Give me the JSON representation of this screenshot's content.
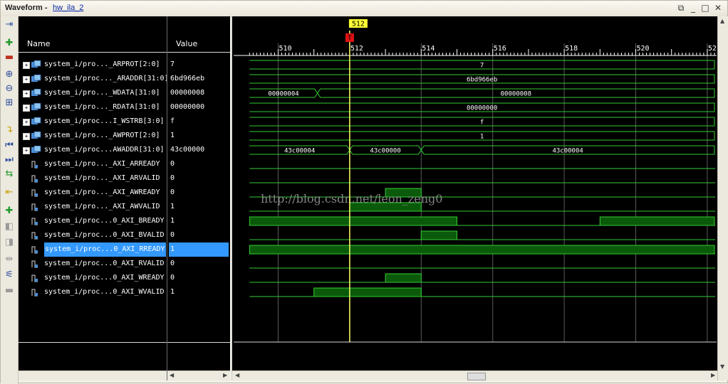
{
  "window": {
    "title_label": "Waveform",
    "title_separator": "-",
    "title_link": "hw_ila_2",
    "controls": {
      "restore": "⧉",
      "minimize": "_",
      "maximize": "□",
      "close": "✕"
    }
  },
  "toolbar": {
    "buttons": [
      {
        "name": "waveform-options-button",
        "icon": "⇥",
        "color": "#3a5fa8"
      },
      {
        "name": "add-probe-button",
        "icon": "✚",
        "color": "#1f9a2b"
      },
      {
        "name": "remove-button",
        "icon": "▬",
        "color": "#c03020"
      },
      {
        "name": "zoom-in-button",
        "icon": "⊕",
        "color": "#2a4c9a"
      },
      {
        "name": "zoom-out-button",
        "icon": "⊖",
        "color": "#2a4c9a"
      },
      {
        "name": "zoom-fit-button",
        "icon": "⊞",
        "color": "#2a4c9a"
      },
      {
        "name": "go-to-cursor-button",
        "icon": "↴",
        "color": "#c8a000"
      },
      {
        "name": "go-to-time-0-button",
        "icon": "⏮",
        "color": "#2a4c9a"
      },
      {
        "name": "go-to-last-time-button",
        "icon": "⏭",
        "color": "#2a4c9a"
      },
      {
        "name": "swap-cursors-button",
        "icon": "⇆",
        "color": "#1f9a2b"
      },
      {
        "name": "previous-transition-button",
        "icon": "⇤",
        "color": "#c8a000"
      },
      {
        "name": "add-marker-button",
        "icon": "✚",
        "color": "#1f9a2b"
      },
      {
        "name": "previous-marker-button",
        "icon": "◧",
        "color": "#9a9a9a"
      },
      {
        "name": "next-marker-button",
        "icon": "◨",
        "color": "#9a9a9a"
      },
      {
        "name": "snap-to-transition-button",
        "icon": "⇹",
        "color": "#9a9a9a"
      },
      {
        "name": "floating-ruler-button",
        "icon": "⚟",
        "color": "#2a4c9a"
      },
      {
        "name": "sync-button",
        "icon": "▬",
        "color": "#9a9a9a"
      }
    ]
  },
  "columns": {
    "name_header": "Name",
    "value_header": "Value"
  },
  "signals": [
    {
      "name": "system_i/pro..._ARPROT[2:0]",
      "value": "7",
      "type": "bus",
      "expandable": true
    },
    {
      "name": "system_i/proc..._ARADDR[31:0]",
      "value": "6bd966eb",
      "type": "bus",
      "expandable": true
    },
    {
      "name": "system_i/pro..._WDATA[31:0]",
      "value": "00000008",
      "type": "bus",
      "expandable": true
    },
    {
      "name": "system_i/pro..._RDATA[31:0]",
      "value": "00000000",
      "type": "bus",
      "expandable": true
    },
    {
      "name": "system_i/proc...I_WSTRB[3:0]",
      "value": "f",
      "type": "bus",
      "expandable": true
    },
    {
      "name": "system_i/pro..._AWPROT[2:0]",
      "value": "1",
      "type": "bus",
      "expandable": true
    },
    {
      "name": "system_i/proc...AWADDR[31:0]",
      "value": "43c00000",
      "type": "bus",
      "expandable": true
    },
    {
      "name": "system_i/pro..._AXI_ARREADY",
      "value": "0",
      "type": "bit"
    },
    {
      "name": "system_i/pro..._AXI_ARVALID",
      "value": "0",
      "type": "bit"
    },
    {
      "name": "system_i/pro..._AXI_AWREADY",
      "value": "0",
      "type": "bit"
    },
    {
      "name": "system_i/pro..._AXI_AWVALID",
      "value": "1",
      "type": "bit"
    },
    {
      "name": "system_i/proc...0_AXI_BREADY",
      "value": "1",
      "type": "bit"
    },
    {
      "name": "system_i/proc...0_AXI_BVALID",
      "value": "0",
      "type": "bit"
    },
    {
      "name": "system_i/proc...0_AXI_RREADY",
      "value": "1",
      "type": "bit",
      "selected": true
    },
    {
      "name": "system_i/proc...0_AXI_RVALID",
      "value": "0",
      "type": "bit"
    },
    {
      "name": "system_i/proc...0_AXI_WREADY",
      "value": "0",
      "type": "bit"
    },
    {
      "name": "system_i/proc...0_AXI_WVALID",
      "value": "1",
      "type": "bit"
    }
  ],
  "timeline": {
    "tick_labels": [
      "510",
      "512",
      "514",
      "516",
      "518",
      "520",
      "52"
    ],
    "cursor_label": "512",
    "trigger_marker": "T",
    "cursor_time": 512
  },
  "waveforms": [
    {
      "kind": "bus",
      "segments": [
        {
          "t0": 509.2,
          "t1": 522.2,
          "label": "7"
        }
      ]
    },
    {
      "kind": "bus",
      "segments": [
        {
          "t0": 509.2,
          "t1": 522.2,
          "label": "6bd966eb"
        }
      ]
    },
    {
      "kind": "bus",
      "segments": [
        {
          "t0": 509.2,
          "t1": 511.1,
          "label": "00000004"
        },
        {
          "t0": 511.1,
          "t1": 522.2,
          "label": "00000008"
        }
      ]
    },
    {
      "kind": "bus",
      "segments": [
        {
          "t0": 509.2,
          "t1": 522.2,
          "label": "00000000"
        }
      ]
    },
    {
      "kind": "bus",
      "segments": [
        {
          "t0": 509.2,
          "t1": 522.2,
          "label": "f"
        }
      ]
    },
    {
      "kind": "bus",
      "segments": [
        {
          "t0": 509.2,
          "t1": 522.2,
          "label": "1"
        }
      ]
    },
    {
      "kind": "bus",
      "segments": [
        {
          "t0": 509.2,
          "t1": 512.0,
          "label": "43c00004"
        },
        {
          "t0": 512.0,
          "t1": 514.0,
          "label": "43c00000"
        },
        {
          "t0": 514.0,
          "t1": 522.2,
          "label": "43c00004"
        }
      ]
    },
    {
      "kind": "bit",
      "high": []
    },
    {
      "kind": "bit",
      "high": []
    },
    {
      "kind": "bit",
      "high": [
        [
          513.0,
          514.0
        ]
      ]
    },
    {
      "kind": "bit",
      "high": [
        [
          512.0,
          514.0
        ]
      ]
    },
    {
      "kind": "bit",
      "high": [
        [
          509.2,
          515.0
        ],
        [
          519.0,
          522.2
        ]
      ]
    },
    {
      "kind": "bit",
      "high": [
        [
          514.0,
          515.0
        ]
      ]
    },
    {
      "kind": "bit",
      "high": [
        [
          509.2,
          522.2
        ]
      ]
    },
    {
      "kind": "bit",
      "high": []
    },
    {
      "kind": "bit",
      "high": [
        [
          513.0,
          514.0
        ]
      ]
    },
    {
      "kind": "bit",
      "high": [
        [
          511.0,
          514.0
        ]
      ]
    }
  ],
  "watermark": "http://blog.csdn.net/leon_zeng0",
  "colors": {
    "background": "#000000",
    "wave": "#33cc33",
    "wave_fill": "#0b5a0b",
    "cursor": "#ffff66",
    "grid": "#5a5a5a",
    "selection": "#3399ff",
    "trigger": "#dd1111"
  }
}
